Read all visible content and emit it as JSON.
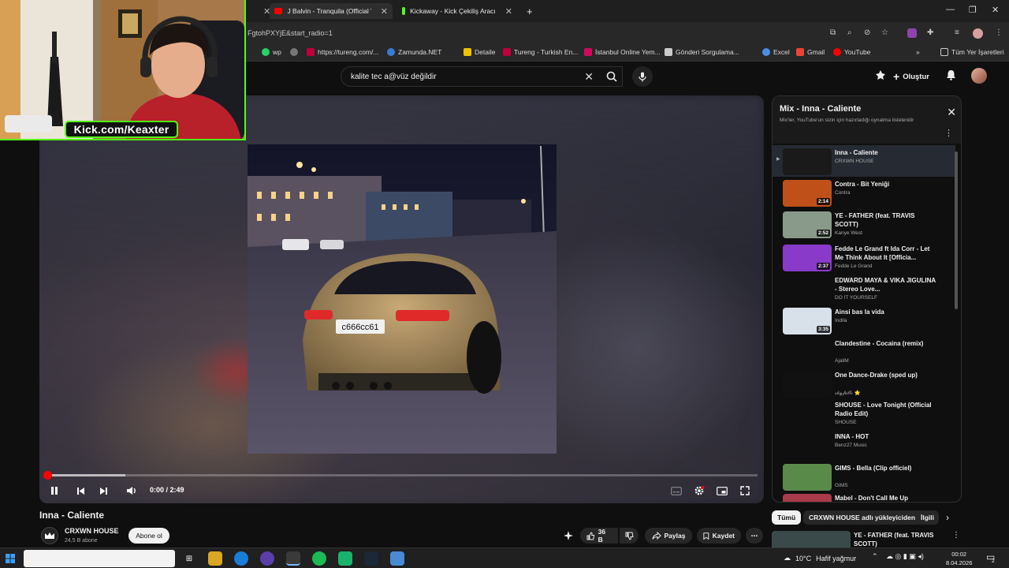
{
  "browser": {
    "tabs": [
      {
        "title": "J Balvin - Tranquila (Official Vid...",
        "color": "#ff0000"
      },
      {
        "title": "Kickaway - Kick Çekiliş Aracı",
        "color": "#53fc18"
      }
    ],
    "url_fragment": "FgtohPXYjE&start_radio=1",
    "bookmarks": [
      {
        "label": "wp",
        "color": "#25d366"
      },
      {
        "label": "https://tureng.com/...",
        "color": "#c0003c"
      },
      {
        "label": "Zamunda.NET",
        "color": "#3a7bd5"
      },
      {
        "label": "Detaile",
        "color": "#f2c200"
      },
      {
        "label": "Tureng - Turkish En...",
        "color": "#c0003c"
      },
      {
        "label": "İstanbul Online Yem...",
        "color": "#d10a5e"
      },
      {
        "label": "Gönderi Sorgulama...",
        "color": "#cccccc"
      },
      {
        "label": "Excel",
        "color": "#4a90e2"
      },
      {
        "label": "Gmail",
        "color": "#ea4335"
      },
      {
        "label": "YouTube",
        "color": "#ff0000"
      }
    ],
    "all_bookmarks": "Tüm Yer İşaretleri"
  },
  "youtube": {
    "search_value": "kalite tec a@vüz değildir",
    "create_label": "Oluştur"
  },
  "webcam": {
    "label": "Kick.com/Keaxter"
  },
  "player": {
    "time": "0:00 / 2:49",
    "progress_fraction": 0.0,
    "hover_fraction": 0.11
  },
  "video": {
    "title": "Inna - Caliente",
    "channel": "CRXWN HOUSE",
    "subscribers": "24,5 B abone",
    "subscribe_label": "Abone ol",
    "likes": "36 B",
    "share_label": "Paylaş",
    "save_label": "Kaydet"
  },
  "mix": {
    "title": "Mix - Inna - Caliente",
    "subtitle": "Mix'ler, YouTube'un sizin için hazırladığı oynatma listeleridir",
    "items": [
      {
        "title": "Inna - Caliente",
        "channel": "CRXWN HOUSE",
        "duration": "",
        "thumb": "#1a1a1a"
      },
      {
        "title": "Contra - Bit Yeniği",
        "channel": "Contra",
        "duration": "2:14",
        "thumb": "#c0501a"
      },
      {
        "title": "YE - FATHER (feat. TRAVIS SCOTT)",
        "channel": "Kanye West",
        "duration": "2:52",
        "thumb": "#8a9a8a"
      },
      {
        "title": "Fedde Le Grand ft Ida Corr - Let Me Think About It [Officia...",
        "channel": "Fedde Le Grand",
        "duration": "2:37",
        "thumb": "#8a3ac8"
      },
      {
        "title": "EDWARD MAYA & VIKA JIGULINA - Stereo Love...",
        "channel": "DO IT YOURSELF",
        "duration": "",
        "thumb": "#0f0f0f"
      },
      {
        "title": "Ainsi bas la vida",
        "channel": "Indila",
        "duration": "3:35",
        "thumb": "#d8e0ea"
      },
      {
        "title": "Clandestine - Cocaina (remix)",
        "channel": "AjaliM",
        "duration": "",
        "thumb": "#0f0f0f"
      },
      {
        "title": "One Dance-Drake (sped up)",
        "channel": "𝓈𝓀𝓎𝒻𝒶𝓁𝓁𝓈 ⭐",
        "duration": "",
        "thumb": "#111111"
      },
      {
        "title": "SHOUSE - Love Tonight (Official Radio Edit)",
        "channel": "SHOUSE",
        "duration": "",
        "thumb": "#0f0f0f"
      },
      {
        "title": "INNA - HOT",
        "channel": "Benz27 Music",
        "duration": "",
        "thumb": "#0f0f0f"
      },
      {
        "title": "GIMS - Bella (Clip officiel)",
        "channel": "GIMS",
        "duration": "",
        "thumb": "#5a8a4a"
      },
      {
        "title": "Mabel - Don't Call Me Up",
        "channel": "",
        "duration": "",
        "thumb": "#a83a4a"
      }
    ]
  },
  "chips": [
    "Tümü",
    "CRXWN HOUSE adlı yükleyiciden",
    "İlgili"
  ],
  "peek": {
    "title": "YE - FATHER (feat. TRAVIS SCOTT)"
  },
  "taskbar": {
    "temperature": "10°C",
    "weather": "Hafif yağmur",
    "time": "00:02",
    "date": "8.04.2026",
    "notif_count": "2"
  },
  "colors": {
    "accent": "#ff0000",
    "kick": "#53fc18"
  }
}
